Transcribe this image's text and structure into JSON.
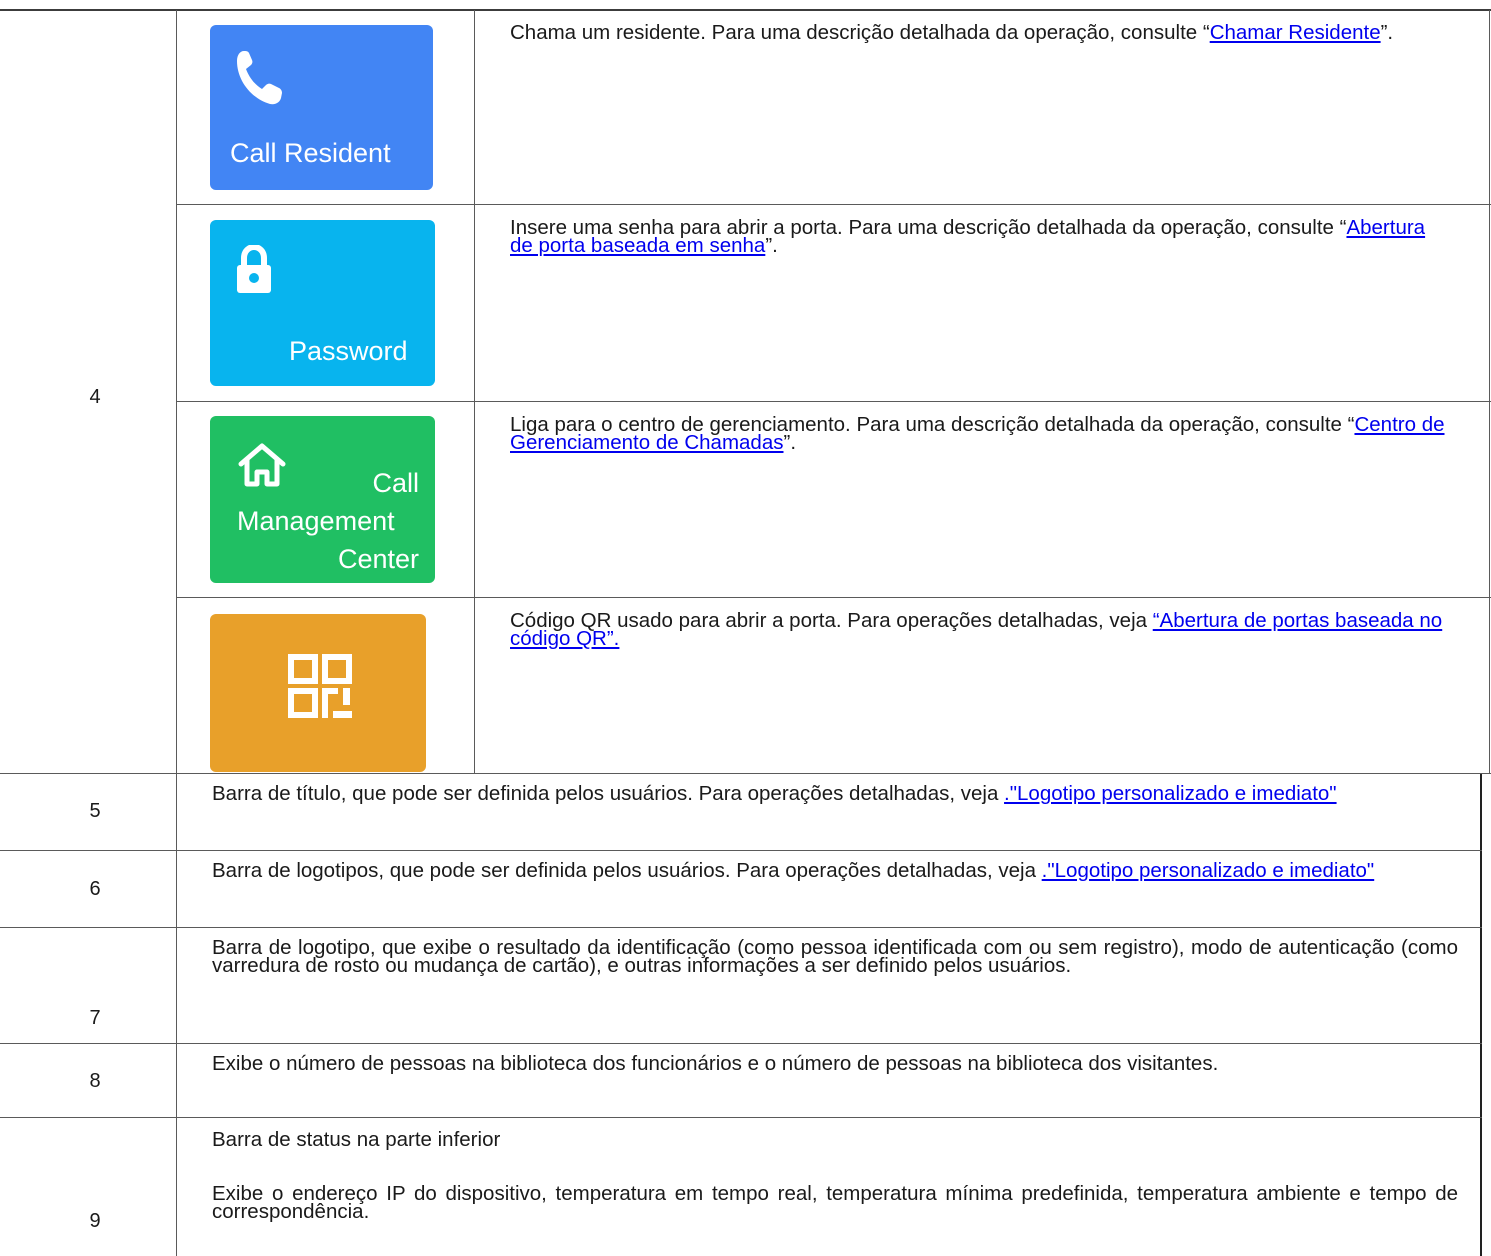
{
  "rows": [
    {
      "num": "4"
    },
    {
      "num": "5",
      "text": "Barra de título, que pode ser definida pelos usuários. Para operações detalhadas, veja ",
      "link": ".\"Logotipo personalizado e imediato\""
    },
    {
      "num": "6",
      "text": "Barra de logotipos, que pode ser definida pelos usuários. Para operações detalhadas, veja ",
      "link": ".\"Logotipo personalizado e imediato\""
    },
    {
      "num": "7",
      "text": "Barra de logotipo, que exibe o resultado da identificação (como pessoa identificada com ou sem registro), modo de autenticação (como varredura de rosto ou mudança de cartão), e outras informações a ser definido pelos usuários."
    },
    {
      "num": "8",
      "text": "Exibe o número de pessoas na biblioteca dos funcionários e o número de pessoas na biblioteca dos visitantes."
    },
    {
      "num": "9",
      "line1": "Barra de status na parte inferior",
      "line2": "Exibe o endereço IP do dispositivo, temperatura em tempo real, temperatura mínima predefinida, temperatura ambiente e tempo de correspondência."
    }
  ],
  "subrows": [
    {
      "tile_label": "Call Resident",
      "icon": "phone-icon",
      "color": "#4285f4",
      "before": "Chama um residente. Para uma descrição detalhada da operação, consulte “",
      "link": "Chamar Residente",
      "after": "”."
    },
    {
      "tile_label": "Password",
      "icon": "lock-icon",
      "color": "#08b4ee",
      "before": "Insere uma senha para abrir a porta. Para uma descrição detalhada da operação, consulte “",
      "link": "Abertura de porta baseada em senha",
      "after": "”."
    },
    {
      "tile_label_1": "Call",
      "tile_label_2": "Management",
      "tile_label_3": "Center",
      "icon": "home-icon",
      "color": "#20bf63",
      "before": "Liga para o centro de gerenciamento. Para uma descrição detalhada da operação, consulte “",
      "link": "Centro de Gerenciamento de Chamadas",
      "after": "”."
    },
    {
      "icon": "qr-code-icon",
      "color": "#e8a02a",
      "before": "Código QR usado para abrir a porta. Para operações detalhadas, veja ",
      "link": "“Abertura de portas baseada no código QR”.",
      "after": ""
    }
  ]
}
